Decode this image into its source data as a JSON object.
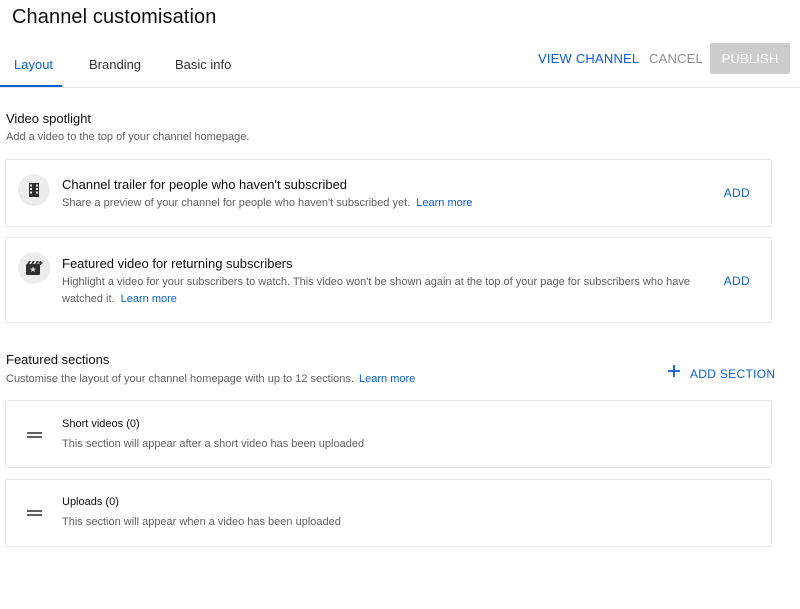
{
  "header": {
    "title": "Channel customisation",
    "tabs": [
      {
        "label": "Layout",
        "active": true
      },
      {
        "label": "Branding",
        "active": false
      },
      {
        "label": "Basic info",
        "active": false
      }
    ],
    "view_channel": "VIEW CHANNEL",
    "cancel": "CANCEL",
    "publish": "PUBLISH"
  },
  "video_spotlight": {
    "title": "Video spotlight",
    "subtitle": "Add a video to the top of your channel homepage.",
    "cards": [
      {
        "icon": "film-icon",
        "title": "Channel trailer for people who haven't subscribed",
        "description": "Share a preview of your channel for people who haven't subscribed yet.",
        "link": "Learn more",
        "action": "ADD"
      },
      {
        "icon": "featured-video-icon",
        "title": "Featured video for returning subscribers",
        "description": "Highlight a video for your subscribers to watch. This video won't be shown again at the top of your page for subscribers who have watched it.",
        "link": "Learn more",
        "action": "ADD"
      }
    ]
  },
  "featured_sections": {
    "title": "Featured sections",
    "subtitle": "Customise the layout of your channel homepage with up to 12 sections.",
    "link": "Learn more",
    "add_section": "ADD SECTION",
    "sections": [
      {
        "title": "Short videos",
        "count": "(0)",
        "description": "This section will appear after a short video has been uploaded"
      },
      {
        "title": "Uploads",
        "count": "(0)",
        "description": "This section will appear when a video has been uploaded"
      }
    ]
  },
  "colors": {
    "accent": "#065fd4",
    "publish_disabled_bg": "#cccccc",
    "muted_text": "#606060",
    "border": "#e5e5e5"
  }
}
